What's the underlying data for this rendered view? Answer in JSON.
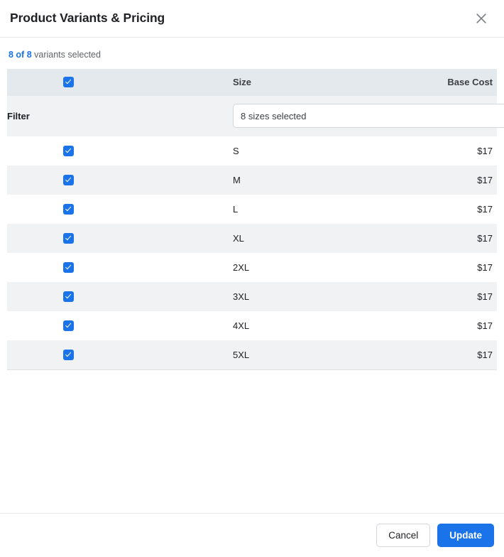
{
  "dialog": {
    "title": "Product Variants & Pricing",
    "close_icon": "close-icon"
  },
  "summary": {
    "count": "8 of 8",
    "label": "variants selected"
  },
  "table": {
    "columns": {
      "select_all": "",
      "size": "Size",
      "base_cost": "Base Cost"
    },
    "filter": {
      "label": "Filter",
      "value": "8 sizes selected",
      "placeholder": "8 sizes selected"
    },
    "rows": [
      {
        "checked": true,
        "size": "S",
        "base_cost": "$17"
      },
      {
        "checked": true,
        "size": "M",
        "base_cost": "$17"
      },
      {
        "checked": true,
        "size": "L",
        "base_cost": "$17"
      },
      {
        "checked": true,
        "size": "XL",
        "base_cost": "$17"
      },
      {
        "checked": true,
        "size": "2XL",
        "base_cost": "$17"
      },
      {
        "checked": true,
        "size": "3XL",
        "base_cost": "$17"
      },
      {
        "checked": true,
        "size": "4XL",
        "base_cost": "$17"
      },
      {
        "checked": true,
        "size": "5XL",
        "base_cost": "$17"
      }
    ]
  },
  "footer": {
    "cancel_label": "Cancel",
    "update_label": "Update"
  },
  "colors": {
    "accent": "#1a73e8",
    "header_row_bg": "#e4e9ee",
    "stripe_bg": "#f1f2f3",
    "text": "#202124",
    "muted_text": "#5f6368",
    "border": "#e8eaed"
  }
}
